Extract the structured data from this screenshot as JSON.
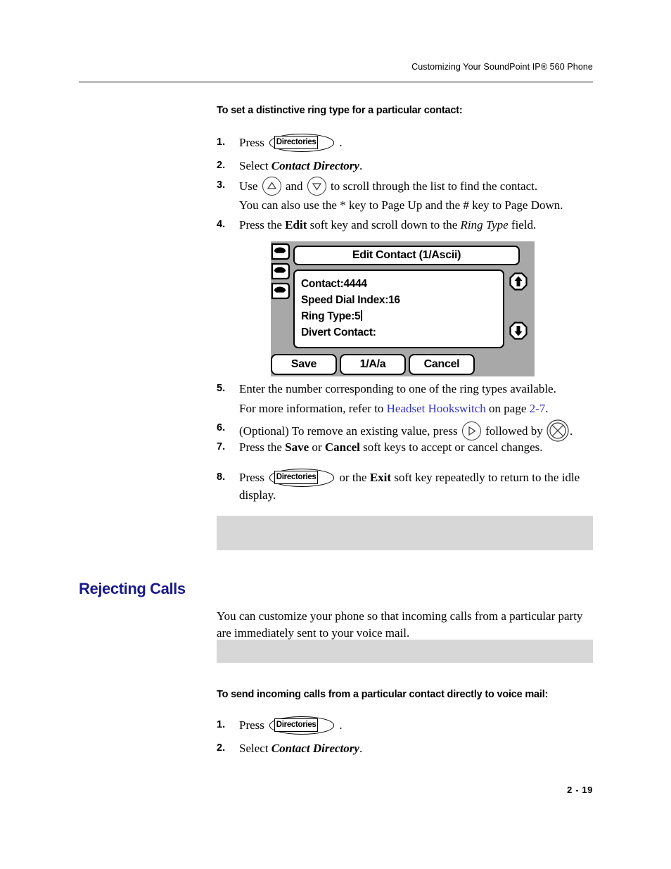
{
  "header": {
    "running_head": "Customizing Your SoundPoint IP® 560 Phone"
  },
  "procedure_1": {
    "title": "To set a distinctive ring type for a particular contact:",
    "steps": [
      {
        "num": "1.",
        "lead": "Press",
        "key": "Directories",
        "trail": "."
      },
      {
        "num": "2.",
        "lead": "Select",
        "emphasis": "Contact Directory",
        "trail": "."
      },
      {
        "num": "3.",
        "lead": "Use",
        "mid": "and",
        "trail": "to scroll through the list to find the contact.",
        "continuation": "You can also use the * key to Page Up and the # key to Page Down."
      },
      {
        "num": "4.",
        "lead": "Press the",
        "softkey": "Edit",
        "mid": "soft key and scroll down to the",
        "field": "Ring Type",
        "trail": "field."
      },
      {
        "num": "5.",
        "text": "Enter the number corresponding to one of the ring types available.",
        "continuation_lead": "For more information, refer to",
        "link_1": "Headset Hookswitch",
        "continuation_mid": "on page",
        "link_2": "2-7",
        "continuation_trail": "."
      },
      {
        "num": "6.",
        "lead": "(Optional) To remove an existing value, press",
        "mid": "followed by",
        "trail": "."
      },
      {
        "num": "7.",
        "lead": "Press the",
        "softkey_a": "Save",
        "mid": "or",
        "softkey_b": "Cancel",
        "trail": "soft keys to accept or cancel changes."
      },
      {
        "num": "8.",
        "lead": "Press",
        "key": "Directories",
        "mid": "or the",
        "softkey": "Exit",
        "trail": "soft key repeatedly to return to the idle",
        "continuation": "display."
      }
    ]
  },
  "lcd_figure": {
    "title": "Edit Contact (1/Ascii)",
    "fields": [
      {
        "label": "Contact:",
        "value": "4444",
        "has_caret": false
      },
      {
        "label": "Speed Dial Index:",
        "value": "16",
        "has_caret": false
      },
      {
        "label": "Ring Type:",
        "value": "5",
        "has_caret": true
      },
      {
        "label": "Divert Contact:",
        "value": "",
        "has_caret": false
      }
    ],
    "softkeys": [
      "Save",
      "1/A/a",
      "Cancel"
    ],
    "line_key_icons": [
      "handset-icon",
      "handset-icon",
      "handset-icon"
    ],
    "scroll_icons": [
      "scroll-up-icon",
      "scroll-down-icon"
    ]
  },
  "notes": {
    "note_1_text": "",
    "note_2_text": ""
  },
  "section": {
    "heading": "Rejecting Calls",
    "intro": "You can customize your phone so that incoming calls from a particular party are immediately sent to your voice mail."
  },
  "procedure_2": {
    "title": "To send incoming calls from a particular contact directly to voice mail:",
    "steps": [
      {
        "num": "1.",
        "lead": "Press",
        "key": "Directories",
        "trail": "."
      },
      {
        "num": "2.",
        "lead": "Select",
        "emphasis": "Contact Directory",
        "trail": "."
      }
    ]
  },
  "footer": {
    "page_number": "2 - 19"
  },
  "colors": {
    "heading_blue": "#1a1a8c",
    "link_blue": "#3333cc",
    "note_gray": "#d7d7d7",
    "rule_gray": "#bfbfbf",
    "lcd_bezel": "#a8a8a8"
  }
}
